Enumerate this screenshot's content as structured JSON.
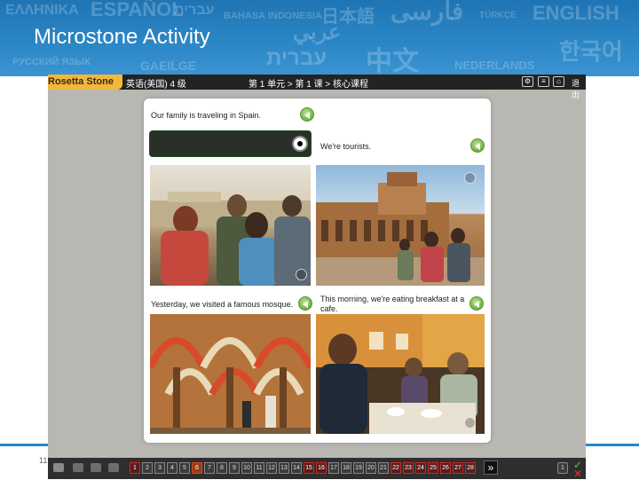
{
  "slide": {
    "title": "Microstone Activity",
    "page_number": "11",
    "background_words": [
      {
        "text": "ΕΛΛΗΝΙΚΑ",
        "size": 16
      },
      {
        "text": "ESPAÑOL",
        "size": 22
      },
      {
        "text": "עברית",
        "size": 16
      },
      {
        "text": "BAHASA INDONESIA",
        "size": 11
      },
      {
        "text": "日本語",
        "size": 20
      },
      {
        "text": "فارسی",
        "size": 28
      },
      {
        "text": "TÜRKÇE",
        "size": 10
      },
      {
        "text": "ENGLISH",
        "size": 22
      },
      {
        "text": "РУССКИЙ ЯЗЫК",
        "size": 11
      },
      {
        "text": "عربي",
        "size": 24
      },
      {
        "text": "GAEILGE",
        "size": 14
      },
      {
        "text": "עברית",
        "size": 24
      },
      {
        "text": "中文",
        "size": 30
      },
      {
        "text": "NEDERLANDS",
        "size": 13
      },
      {
        "text": "한국어",
        "size": 26
      }
    ]
  },
  "app": {
    "logo": "Rosetta Stone",
    "course": "英语(美国) 4 级",
    "breadcrumb": "第 1 单元 > 第 1 课 > 核心课程",
    "exit_label": "退出"
  },
  "activity": {
    "captions": {
      "c1": "Our family is traveling in Spain.",
      "c2": "We're tourists.",
      "c3": "Yesterday, we visited a famous mosque.",
      "c4": "This morning, we're eating breakfast at a",
      "c4b": "cafe."
    }
  },
  "nav": {
    "items": [
      "1",
      "2",
      "3",
      "4",
      "5",
      "6",
      "7",
      "8",
      "9",
      "10",
      "11",
      "12",
      "13",
      "14",
      "15",
      "16",
      "17",
      "18",
      "19",
      "20",
      "21",
      "22",
      "23",
      "24",
      "25",
      "26",
      "27",
      "28"
    ],
    "next_label": "»",
    "hint_label": "1"
  },
  "colors": {
    "banner": "#2b86c6",
    "app_bg": "#b9b7b2",
    "speaker_green": "#6fb03f",
    "nav_red": "#cc2a2a",
    "logo_gold": "#f2b83c"
  }
}
